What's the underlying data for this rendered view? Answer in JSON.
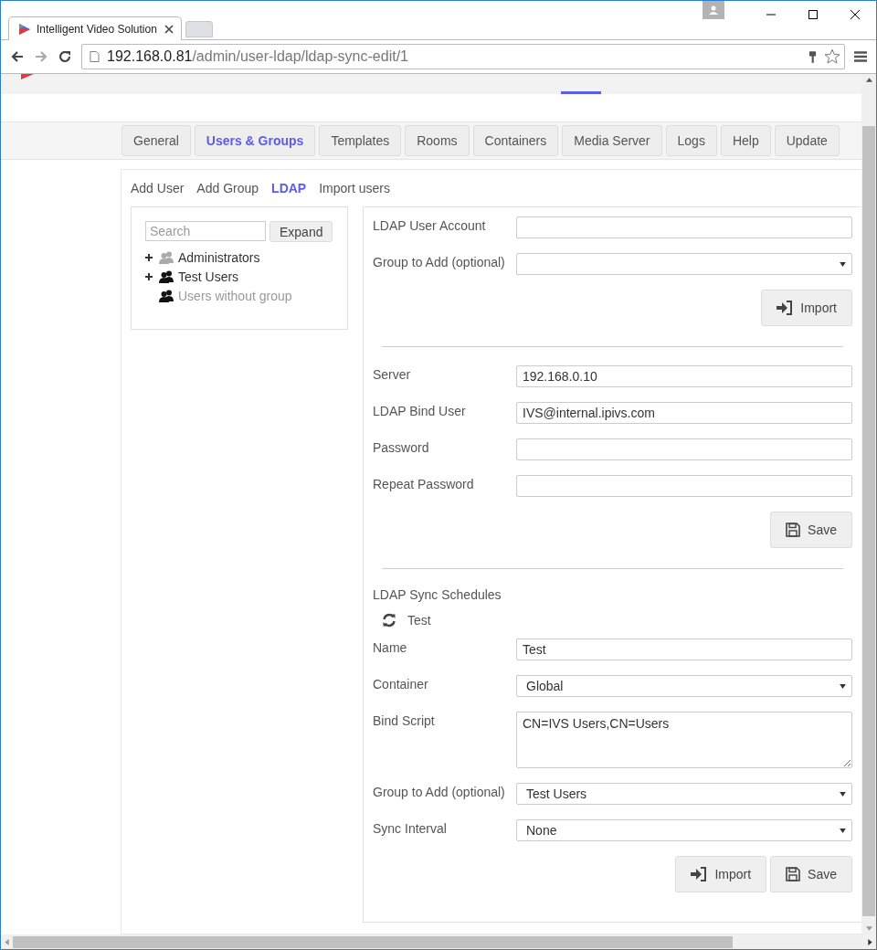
{
  "browser": {
    "tab_title": "Intelligent Video Solution",
    "url_host": "192.168.0.81",
    "url_path": "/admin/user-ldap/ldap-sync-edit/1"
  },
  "nav_tabs": [
    {
      "label": "General",
      "selected": false
    },
    {
      "label": "Users & Groups",
      "selected": true
    },
    {
      "label": "Templates",
      "selected": false
    },
    {
      "label": "Rooms",
      "selected": false
    },
    {
      "label": "Containers",
      "selected": false
    },
    {
      "label": "Media Server",
      "selected": false
    },
    {
      "label": "Logs",
      "selected": false
    },
    {
      "label": "Help",
      "selected": false
    },
    {
      "label": "Update",
      "selected": false
    }
  ],
  "sub_nav": [
    {
      "label": "Add User",
      "selected": false
    },
    {
      "label": "Add Group",
      "selected": false
    },
    {
      "label": "LDAP",
      "selected": true
    },
    {
      "label": "Import users",
      "selected": false
    }
  ],
  "tree": {
    "search_placeholder": "Search",
    "expand_button": "Expand",
    "groups": [
      {
        "name": "Administrators",
        "has_children": true,
        "icon_muted": true,
        "label_muted": false
      },
      {
        "name": "Test Users",
        "has_children": true,
        "icon_muted": false,
        "label_muted": false
      },
      {
        "name": "Users without group",
        "has_children": false,
        "icon_muted": false,
        "label_muted": true
      }
    ]
  },
  "sections": [
    {
      "fields": [
        {
          "label": "LDAP User Account",
          "kind": "text"
        },
        {
          "label": "Group to Add (optional)",
          "kind": "select"
        }
      ],
      "buttons": [
        {
          "label": "Import",
          "kind": "import"
        }
      ]
    },
    {
      "fields": [
        {
          "label": "Server",
          "kind": "text",
          "value": "192.168.0.10"
        },
        {
          "label": "LDAP Bind User",
          "kind": "text",
          "value": "IVS@internal.ipivs.com"
        },
        {
          "label": "Password",
          "kind": "text"
        },
        {
          "label": "Repeat Password",
          "kind": "text"
        }
      ],
      "buttons": [
        {
          "label": "Save",
          "kind": "save"
        }
      ]
    },
    {
      "heading": "LDAP Sync Schedules",
      "schedules": [
        "Test"
      ],
      "fields": [
        {
          "label": "Name",
          "kind": "text",
          "value": "Test"
        },
        {
          "label": "Container",
          "kind": "select",
          "value": "Global"
        },
        {
          "label": "Bind Script",
          "kind": "textarea",
          "value": "CN=IVS Users,CN=Users"
        },
        {
          "label": "Group to Add (optional)",
          "kind": "select",
          "value": "Test Users"
        },
        {
          "label": "Sync Interval",
          "kind": "select",
          "value": "None"
        }
      ],
      "buttons": [
        {
          "label": "Import",
          "kind": "import"
        },
        {
          "label": "Save",
          "kind": "save"
        }
      ]
    }
  ]
}
